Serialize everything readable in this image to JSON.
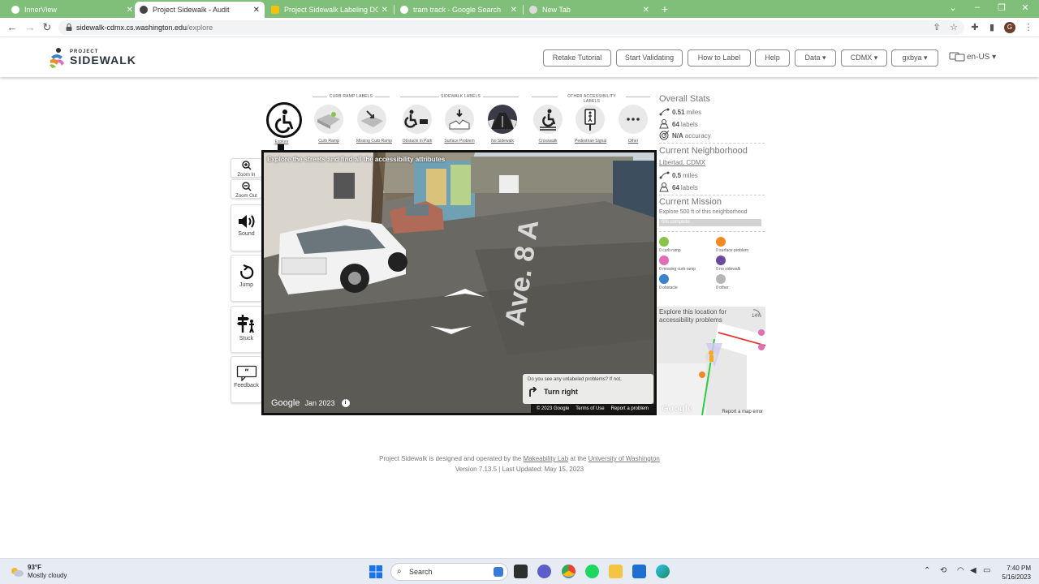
{
  "browser": {
    "tabs": [
      {
        "label": "InnerView",
        "active": false
      },
      {
        "label": "Project Sidewalk - Audit",
        "active": true
      },
      {
        "label": "Project Sidewalk Labeling DOs an",
        "active": false
      },
      {
        "label": "tram track - Google Search",
        "active": false
      },
      {
        "label": "New Tab",
        "active": false
      }
    ],
    "url_host": "sidewalk-cdmx.cs.washington.edu",
    "url_path": "/explore",
    "profile_initial": "G"
  },
  "header": {
    "logo_small": "PROJECT",
    "logo_big": "SIDEWALK",
    "buttons": {
      "retake": "Retake Tutorial",
      "validate": "Start Validating",
      "howto": "How to Label",
      "help": "Help",
      "data": "Data",
      "city": "CDMX",
      "user": "gxbya"
    },
    "language": "en-US"
  },
  "label_toolbar": {
    "groups": {
      "curb": "CURB RAMP LABELS",
      "sidewalk": "SIDEWALK LABELS",
      "other": "OTHER ACCESSIBILITY LABELS"
    },
    "tools": {
      "explore": "Explore",
      "curb_ramp": "Curb Ramp",
      "missing_curb_ramp": "Missing Curb Ramp",
      "obstacle": "Obstacle in Path",
      "surface": "Surface Problem",
      "no_sidewalk": "No Sidewalk",
      "crosswalk": "Crosswalk",
      "ped_signal": "Pedestrian Signal",
      "other": "Other"
    }
  },
  "controls": {
    "zoom_in": "Zoom In",
    "zoom_out": "Zoom Out",
    "sound": "Sound",
    "jump": "Jump",
    "stuck": "Stuck",
    "feedback": "Feedback"
  },
  "pano": {
    "title": "Explore the streets and find all the accessibility attributes",
    "street_text": "Ave. 8 A",
    "google": "Google",
    "date": "Jan 2023",
    "legal": [
      "© 2023 Google",
      "Terms of Use",
      "Report a problem"
    ],
    "hint_question": "Do you see any unlabeled problems? If not,",
    "hint_action": "Turn right"
  },
  "stats": {
    "overall_title": "Overall Stats",
    "miles_value": "0.51",
    "miles_unit": "miles",
    "labels_value": "64",
    "labels_unit": "labels",
    "accuracy_value": "N/A",
    "accuracy_unit": "accuracy",
    "neighborhood_title": "Current Neighborhood",
    "neighborhood_name": "Libertad, CDMX",
    "nb_miles_value": "0.5",
    "nb_miles_unit": "miles",
    "nb_labels_value": "64",
    "nb_labels_unit": "labels",
    "mission_title": "Current Mission",
    "mission_desc": "Explore 500 ft of this neighborhood",
    "mission_progress_label": "0% complete",
    "mission_progress": 0
  },
  "mission_legend": [
    {
      "label": "0 curb ramp",
      "color": "#8bc34a"
    },
    {
      "label": "0 surface problem",
      "color": "#f08a24"
    },
    {
      "label": "0 missing curb ramp",
      "color": "#e06fb5"
    },
    {
      "label": "0 no sidewalk",
      "color": "#6a4a9c"
    },
    {
      "label": "0 obstacle",
      "color": "#3a82c9"
    },
    {
      "label": "0 other",
      "color": "#b5b5b5"
    }
  ],
  "minimap": {
    "text": "Explore this location for accessibility problems",
    "percent": "14%",
    "google": "Google",
    "report": "Report a map error"
  },
  "footer": {
    "line1_pre": "Project Sidewalk is designed and operated by the",
    "lab": "Makeability Lab",
    "line1_mid": "at the",
    "uni": "University of Washington",
    "line2": "Version 7.13.5 | Last Updated: May 15, 2023"
  },
  "taskbar": {
    "temp": "93°F",
    "weather": "Mostly cloudy",
    "search": "Search",
    "time": "7:40 PM",
    "date": "5/16/2023"
  },
  "colors": {
    "tab_strip": "#7fbf7a",
    "accent_text": "#777777"
  }
}
